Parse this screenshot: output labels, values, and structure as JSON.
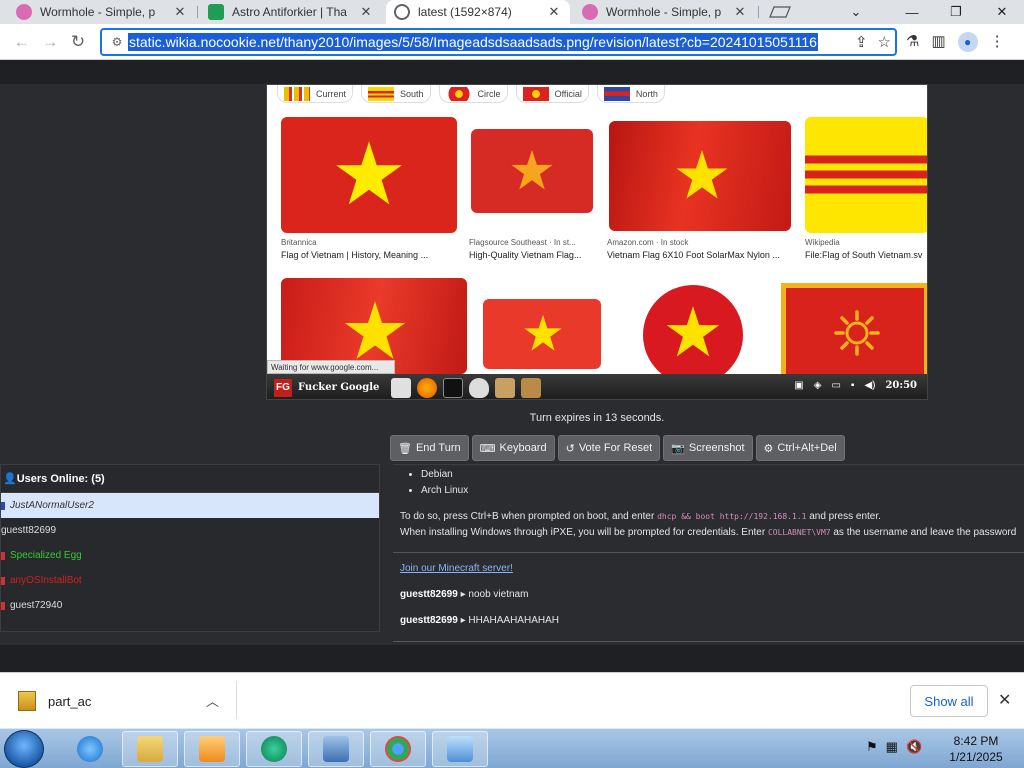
{
  "browser": {
    "tabs": [
      {
        "title": "Wormhole - Simple, p",
        "active": false
      },
      {
        "title": "Astro Antiforkier | Tha",
        "active": false
      },
      {
        "title": "latest (1592×874)",
        "active": true
      },
      {
        "title": "Wormhole - Simple, p",
        "active": false
      }
    ],
    "tab_close": "✕",
    "url": "static.wikia.nocookie.net/thany2010/images/5/58/Imageadsdsaadsads.png/revision/latest?cb=20241015051116"
  },
  "vm": {
    "chips": [
      {
        "label": "Current"
      },
      {
        "label": "South"
      },
      {
        "label": "Circle"
      },
      {
        "label": "Official"
      },
      {
        "label": "North"
      }
    ],
    "results": [
      {
        "source": "Britannica",
        "caption": "Flag of Vietnam | History, Meaning ..."
      },
      {
        "source": "Flagsource Southeast · In st...",
        "caption": "High-Quality Vietnam Flag..."
      },
      {
        "source": "Amazon.com · In stock",
        "caption": "Vietnam Flag 6X10 Foot SolarMax Nylon ..."
      },
      {
        "source": "Wikipedia",
        "caption": "File:Flag of South Vietnam.sv"
      }
    ],
    "status_text": "Waiting for www.google.com...",
    "taskbar_logo": "FG",
    "taskbar_title": "Fucker Google",
    "clock": "20:50"
  },
  "turn_text": "Turn expires in 13 seconds.",
  "controls": {
    "end_turn": "End Turn",
    "keyboard": "Keyboard",
    "vote_reset": "Vote For Reset",
    "screenshot": "Screenshot",
    "cad": "Ctrl+Alt+Del"
  },
  "users": {
    "header": "Users Online: (5)",
    "list": [
      {
        "name": "JustANormalUser2",
        "color": "#333333",
        "flag": "#2b4aa8"
      },
      {
        "name": "guestt82699",
        "color": "#dddddd",
        "flag": ""
      },
      {
        "name": "Specialized Egg",
        "color": "#33cc33",
        "flag": "#cc3333"
      },
      {
        "name": "anyOSInstallBot",
        "color": "#d02020",
        "flag": "#cc3333"
      },
      {
        "name": "guest72940",
        "color": "#dddddd",
        "flag": "#cc3333"
      }
    ]
  },
  "chat": {
    "list_items": [
      "Debian",
      "Arch Linux"
    ],
    "line1_a": "To do so, press Ctrl+B when prompted on boot, and enter",
    "line1_code": "dhcp && boot http://192.168.1.1",
    "line1_b": "and press enter.",
    "line2_a": "When installing Windows through iPXE, you will be prompted for credentials. Enter",
    "line2_code": "COLLABNET\\VM7",
    "line2_b": "as the username and leave the password",
    "minecraft_link": "Join our Minecraft server!",
    "messages": [
      {
        "user": "guestt82699",
        "text": "noob vietnam"
      },
      {
        "user": "guestt82699",
        "text": "HHAHAAHAHAHAH"
      }
    ],
    "arrow": "▸"
  },
  "download": {
    "file": "part_ac",
    "show_all": "Show all"
  },
  "windows": {
    "time": "8:42 PM",
    "date": "1/21/2025"
  },
  "colors": {
    "flag_red": "#da251d",
    "star_yellow": "#ffec00",
    "accent": "#1a73e8"
  }
}
